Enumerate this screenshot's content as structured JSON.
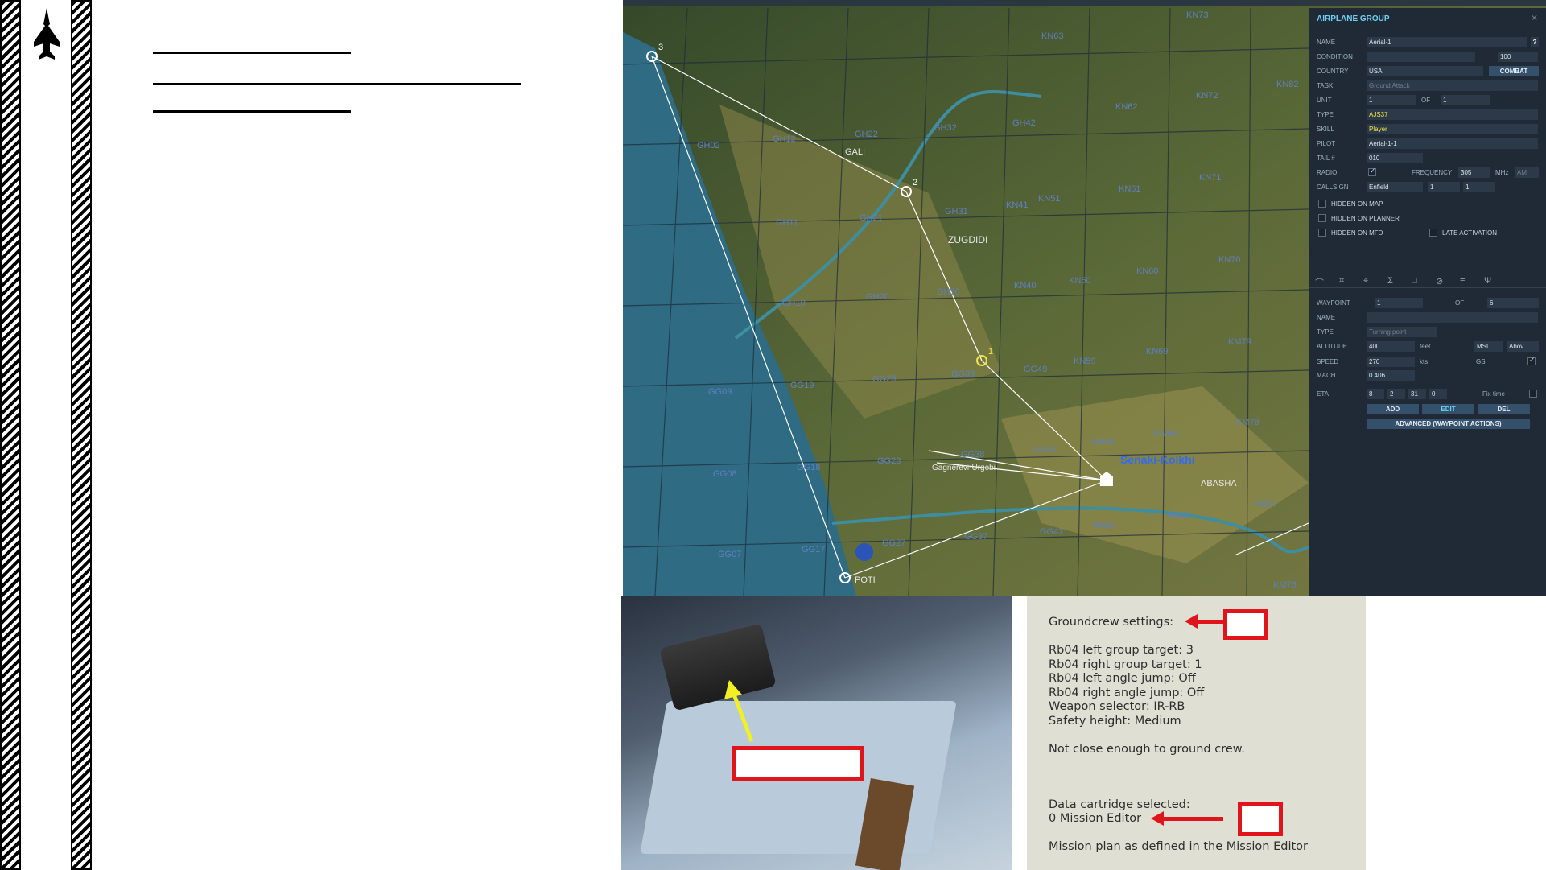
{
  "map": {
    "place_labels": [
      "Senaki-Kolkhi",
      "ZUGDIDI",
      "GALI",
      "POTI",
      "ABASHA",
      "Gagnerevi-Urgebi"
    ],
    "grid_labels": [
      "KN73",
      "KN63",
      "KN72",
      "KN62",
      "KN82",
      "KN71",
      "KN61",
      "KN51",
      "KN41",
      "KN60",
      "KN70",
      "KN50",
      "KN40",
      "KN69",
      "KN59",
      "KM79",
      "KM78",
      "KM68",
      "KM58",
      "KM77",
      "KM67",
      "KM57",
      "KM76",
      "GH31",
      "GH21",
      "GH11",
      "GH30",
      "GH20",
      "GH10",
      "GH22",
      "GH12",
      "GH02",
      "GH32",
      "GH42",
      "GG39",
      "GG29",
      "GG49",
      "GG19",
      "GG09",
      "GG28",
      "GG38",
      "GG48",
      "GG18",
      "GG08",
      "GG27",
      "GG17",
      "GG07",
      "GG37",
      "GG47"
    ],
    "waypoint_labels": [
      "1",
      "2",
      "3"
    ],
    "accent_route": "#ffffff",
    "accent_selected": "#f3e24a"
  },
  "editor": {
    "title": "AIRPLANE GROUP",
    "close_icon": "close-icon",
    "fields": {
      "name": {
        "label": "NAME",
        "value": "Aerial-1"
      },
      "condition": {
        "label": "CONDITION",
        "value": "100"
      },
      "country": {
        "label": "COUNTRY",
        "value": "USA",
        "button": "COMBAT"
      },
      "task": {
        "label": "TASK",
        "value": "Ground Attack"
      },
      "unit": {
        "label": "UNIT",
        "value": "1",
        "of": "OF",
        "total": "1"
      },
      "type": {
        "label": "TYPE",
        "value": "AJS37"
      },
      "skill": {
        "label": "SKILL",
        "value": "Player"
      },
      "pilot": {
        "label": "PILOT",
        "value": "Aerial-1-1"
      },
      "tail": {
        "label": "TAIL #",
        "value": "010"
      },
      "radio": {
        "label": "RADIO",
        "freq_label": "FREQUENCY",
        "freq": "305",
        "unit": "MHz",
        "mod": "AM"
      },
      "callsign": {
        "label": "CALLSIGN",
        "value": "Enfield",
        "n1": "1",
        "n2": "1"
      }
    },
    "checks": {
      "hidden_map": "HIDDEN ON MAP",
      "hidden_planner": "HIDDEN ON PLANNER",
      "hidden_mfd": "HIDDEN ON MFD",
      "late": "LATE ACTIVATION"
    },
    "waypoint": {
      "label": "WAYPOINT",
      "value": "1",
      "of": "OF",
      "total": "6",
      "name_label": "NAME",
      "type_label": "TYPE",
      "type": "Turning point",
      "alt_label": "ALTITUDE",
      "alt": "400",
      "alt_unit": "feet",
      "alt_ref": "MSL",
      "alt_ref2": "Abov",
      "speed_label": "SPEED",
      "speed": "270",
      "speed_unit": "kts",
      "speed_ref": "GS",
      "mach_label": "MACH",
      "mach": "0.406",
      "eta_label": "ETA",
      "eta": [
        "8",
        "2",
        "31",
        "0"
      ],
      "fix_label": "Fix time",
      "add": "ADD",
      "edit": "EDIT",
      "del": "DEL",
      "advanced": "ADVANCED (WAYPOINT ACTIONS)"
    }
  },
  "groundcrew": {
    "title": "Groundcrew settings:",
    "lines": [
      "Rb04 left group target: 3",
      "Rb04 right group target: 1",
      "Rb04 left angle jump: Off",
      "Rb04 right angle jump: Off",
      "Weapon selector: IR-RB",
      "Safety height: Medium"
    ],
    "status": "Not close enough to ground crew.",
    "cartridge_label": "Data cartridge selected:",
    "cartridge_value": "0 Mission Editor",
    "plan": "Mission plan as defined in the Mission Editor"
  }
}
